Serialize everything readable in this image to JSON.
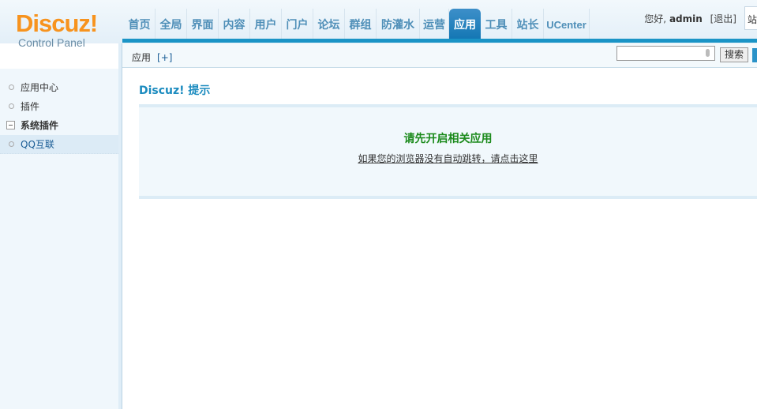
{
  "logo": {
    "brand": "Discuz!",
    "sub": "Control Panel"
  },
  "nav": [
    {
      "label": "首页"
    },
    {
      "label": "全局"
    },
    {
      "label": "界面"
    },
    {
      "label": "内容"
    },
    {
      "label": "用户"
    },
    {
      "label": "门户"
    },
    {
      "label": "论坛"
    },
    {
      "label": "群组"
    },
    {
      "label": "防灌水"
    },
    {
      "label": "运营"
    },
    {
      "label": "应用",
      "active": true
    },
    {
      "label": "工具"
    },
    {
      "label": "站长"
    },
    {
      "label": "UCenter"
    }
  ],
  "user": {
    "greeting": "您好,",
    "name": "admin",
    "logout": "[退出]",
    "site_box": "站"
  },
  "subhead": {
    "crumb": "应用",
    "add": "[+]",
    "search_placeholder": "",
    "search_button": "搜索"
  },
  "sidebar": {
    "items": [
      {
        "label": "应用中心"
      },
      {
        "label": "插件"
      },
      {
        "label": "系统插件"
      },
      {
        "label": "QQ互联"
      }
    ]
  },
  "main": {
    "title": "Discuz! 提示",
    "message": "请先开启相关应用",
    "link": "如果您的浏览器没有自动跳转，请点击这里"
  },
  "colors": {
    "accent": "#1a94c6",
    "logo": "#f7931e",
    "message": "#1b8a1b"
  }
}
